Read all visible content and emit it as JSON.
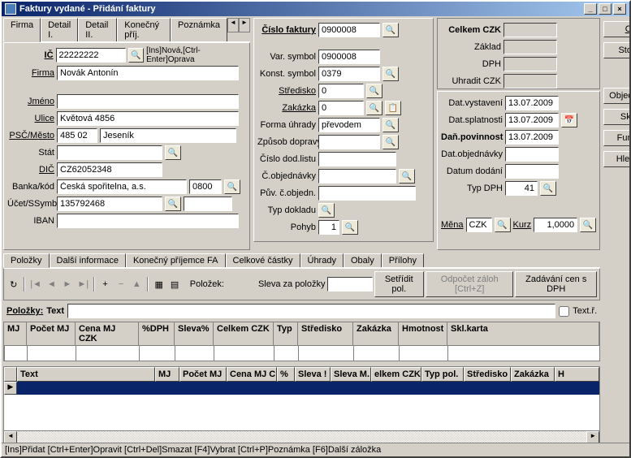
{
  "title": "Faktury vydané - Přidání faktury",
  "tabs_top": [
    "Firma",
    "Detail I.",
    "Detail II.",
    "Konečný příj.",
    "Poznámka"
  ],
  "firma": {
    "ic_lbl": "IČ",
    "ic_val": "22222222",
    "hint": "[Ins]Nová,[Ctrl-Enter]Oprava",
    "firma_lbl": "Firma",
    "firma_val": "Novák Antonín",
    "jmeno_lbl": "Jméno",
    "jmeno_val": "",
    "ulice_lbl": "Ulice",
    "ulice_val": "Květová 4856",
    "psc_lbl": "PSČ/Město",
    "psc_val": "485 02",
    "mesto_val": "Jeseník",
    "stat_lbl": "Stát",
    "stat_val": "",
    "dic_lbl": "DIČ",
    "dic_val": "CZ62052348",
    "banka_lbl": "Banka/kód",
    "banka_val": "Česká spořitelna, a.s.",
    "banka_kod": "0800",
    "ucet_lbl": "Účet/SSymb",
    "ucet_val": "135792468",
    "ssymb_val": "",
    "iban_lbl": "IBAN",
    "iban_val": ""
  },
  "invoice": {
    "cislo_lbl": "Číslo faktury",
    "cislo_val": "0900008",
    "var_lbl": "Var. symbol",
    "var_val": "0900008",
    "konst_lbl": "Konst. symbol",
    "konst_val": "0379",
    "stred_lbl": "Středisko",
    "stred_val": "0",
    "zakazka_lbl": "Zakázka",
    "zakazka_val": "0",
    "forma_lbl": "Forma úhrady",
    "forma_val": "převodem",
    "doprava_lbl": "Způsob dopravy",
    "doprava_val": "",
    "dodlist_lbl": "Číslo dod.listu",
    "dodlist_val": "",
    "cobjed_lbl": "Č.objednávky",
    "cobjed_val": "",
    "puvobj_lbl": "Pův. č.objedn.",
    "puvobj_val": "",
    "typdok_lbl": "Typ dokladu",
    "pohyb_lbl": "Pohyb",
    "pohyb_val": "1",
    "mena_lbl": "Měna",
    "mena_val": "CZK",
    "kurz_lbl": "Kurz",
    "kurz_val": "1,0000"
  },
  "totals": {
    "celkem_lbl": "Celkem CZK",
    "zaklad_lbl": "Základ",
    "dph_lbl": "DPH",
    "uhradit_lbl": "Uhradit CZK"
  },
  "dates": {
    "vyst_lbl": "Dat.vystavení",
    "vyst_val": "13.07.2009",
    "splat_lbl": "Dat.splatnosti",
    "splat_val": "13.07.2009",
    "danpov_lbl": "Daň.povinnost",
    "danpov_val": "13.07.2009",
    "objed_lbl": "Dat.objednávky",
    "objed_val": "",
    "dodani_lbl": "Datum dodání",
    "dodani_val": "",
    "typdph_lbl": "Typ DPH",
    "typdph_val": "41"
  },
  "side": {
    "ok": "OK",
    "storno": "Storno",
    "objed": "Objednávky",
    "sklad": "Sklad",
    "funkce": "Funkce",
    "hledani": "Hledání"
  },
  "tabs_detail": [
    "Položky",
    "Další informace",
    "Konečný příjemce FA",
    "Celkové částky",
    "Úhrady",
    "Obaly",
    "Přílohy"
  ],
  "toolbar": {
    "polozek_lbl": "Položek:",
    "sleva_lbl": "Sleva za položky",
    "setridit": "Setřídit pol.",
    "odpocet": "Odpočet záloh [Ctrl+Z]",
    "zadavani": "Zadávání cen s DPH"
  },
  "items": {
    "polozky_lbl": "Položky:",
    "text_lbl": "Text",
    "textr_lbl": "Text.ř."
  },
  "gridhead1": [
    "MJ",
    "Počet MJ",
    "Cena MJ CZK",
    "%DPH",
    "Sleva%",
    "Celkem CZK",
    "Typ",
    "Středisko",
    "Zakázka",
    "Hmotnost",
    "Skl.karta"
  ],
  "gridhead2": [
    "Text",
    "MJ",
    "Počet MJ",
    "Cena MJ C",
    "%",
    "Sleva !",
    "Sleva M.",
    "elkem CZK",
    "Typ pol.",
    "Středisko",
    "Zakázka",
    "H"
  ],
  "status": "[Ins]Přidat [Ctrl+Enter]Opravit [Ctrl+Del]Smazat [F4]Vybrat [Ctrl+P]Poznámka [F6]Další záložka"
}
